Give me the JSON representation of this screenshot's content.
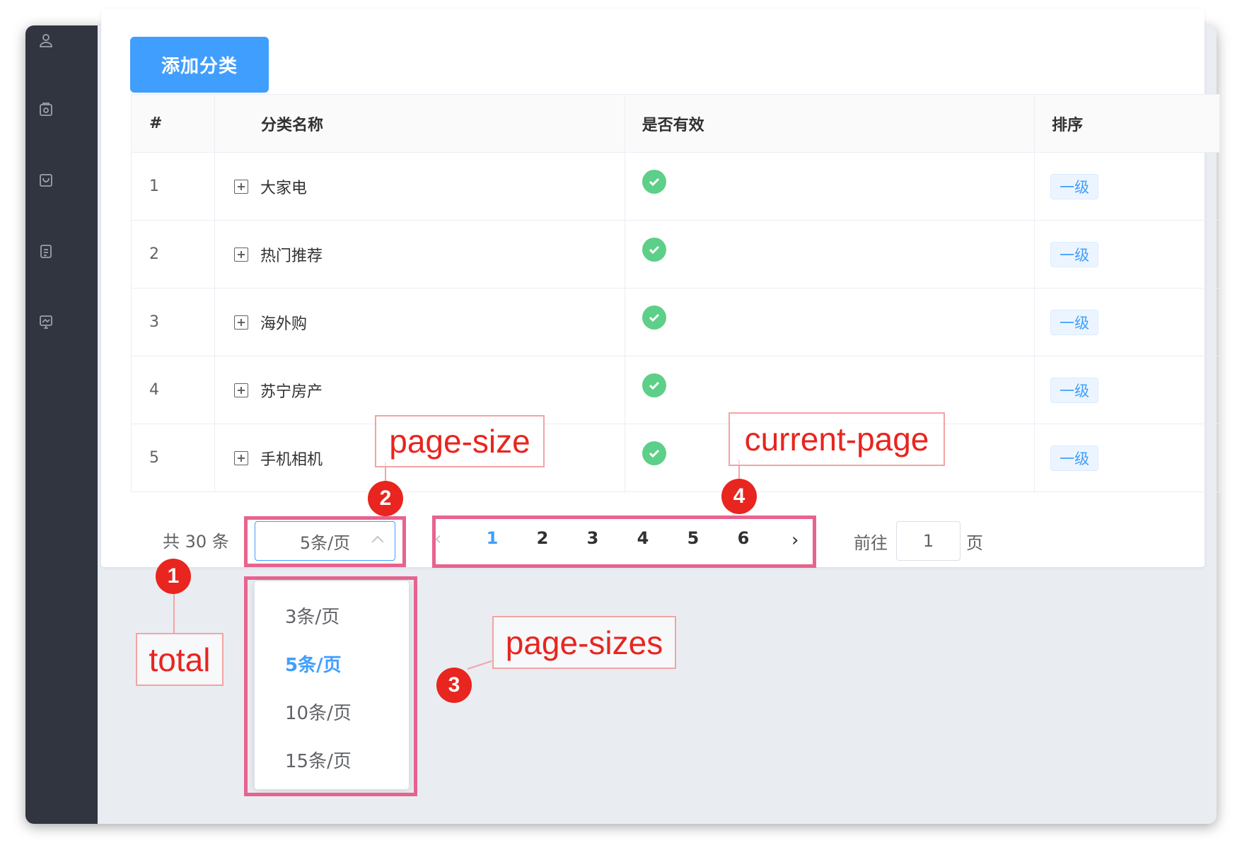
{
  "toolbar": {
    "add_button": "添加分类"
  },
  "table": {
    "headers": [
      "#",
      "分类名称",
      "是否有效",
      "排序"
    ],
    "rows": [
      {
        "index": "1",
        "name": "大家电",
        "valid": true,
        "level": "一级"
      },
      {
        "index": "2",
        "name": "热门推荐",
        "valid": true,
        "level": "一级"
      },
      {
        "index": "3",
        "name": "海外购",
        "valid": true,
        "level": "一级"
      },
      {
        "index": "4",
        "name": "苏宁房产",
        "valid": true,
        "level": "一级"
      },
      {
        "index": "5",
        "name": "手机相机",
        "valid": true,
        "level": "一级"
      }
    ]
  },
  "pagination": {
    "total_text": "共 30 条",
    "page_size": "5条/页",
    "pages": [
      "1",
      "2",
      "3",
      "4",
      "5",
      "6"
    ],
    "current_page": "1",
    "goto_label": "前往",
    "goto_value": "1",
    "goto_suffix": "页",
    "page_sizes": [
      "3条/页",
      "5条/页",
      "10条/页",
      "15条/页"
    ],
    "selected_size": "5条/页"
  },
  "annotations": {
    "total": {
      "num": "1",
      "label": "total"
    },
    "page_size": {
      "num": "2",
      "label": "page-size"
    },
    "page_sizes": {
      "num": "3",
      "label": "page-sizes"
    },
    "current_page": {
      "num": "4",
      "label": "current-page"
    }
  },
  "colors": {
    "primary": "#409eff",
    "sidebar": "#30353f",
    "success": "#5dcf88",
    "annotation": "#e8251f",
    "highlight": "#e7638e"
  },
  "icons": [
    "user-icon",
    "product-icon",
    "cart-icon",
    "order-icon",
    "report-icon",
    "plus-square-icon",
    "check-circle-icon",
    "chevron-up-icon",
    "chevron-left-icon",
    "chevron-right-icon"
  ]
}
